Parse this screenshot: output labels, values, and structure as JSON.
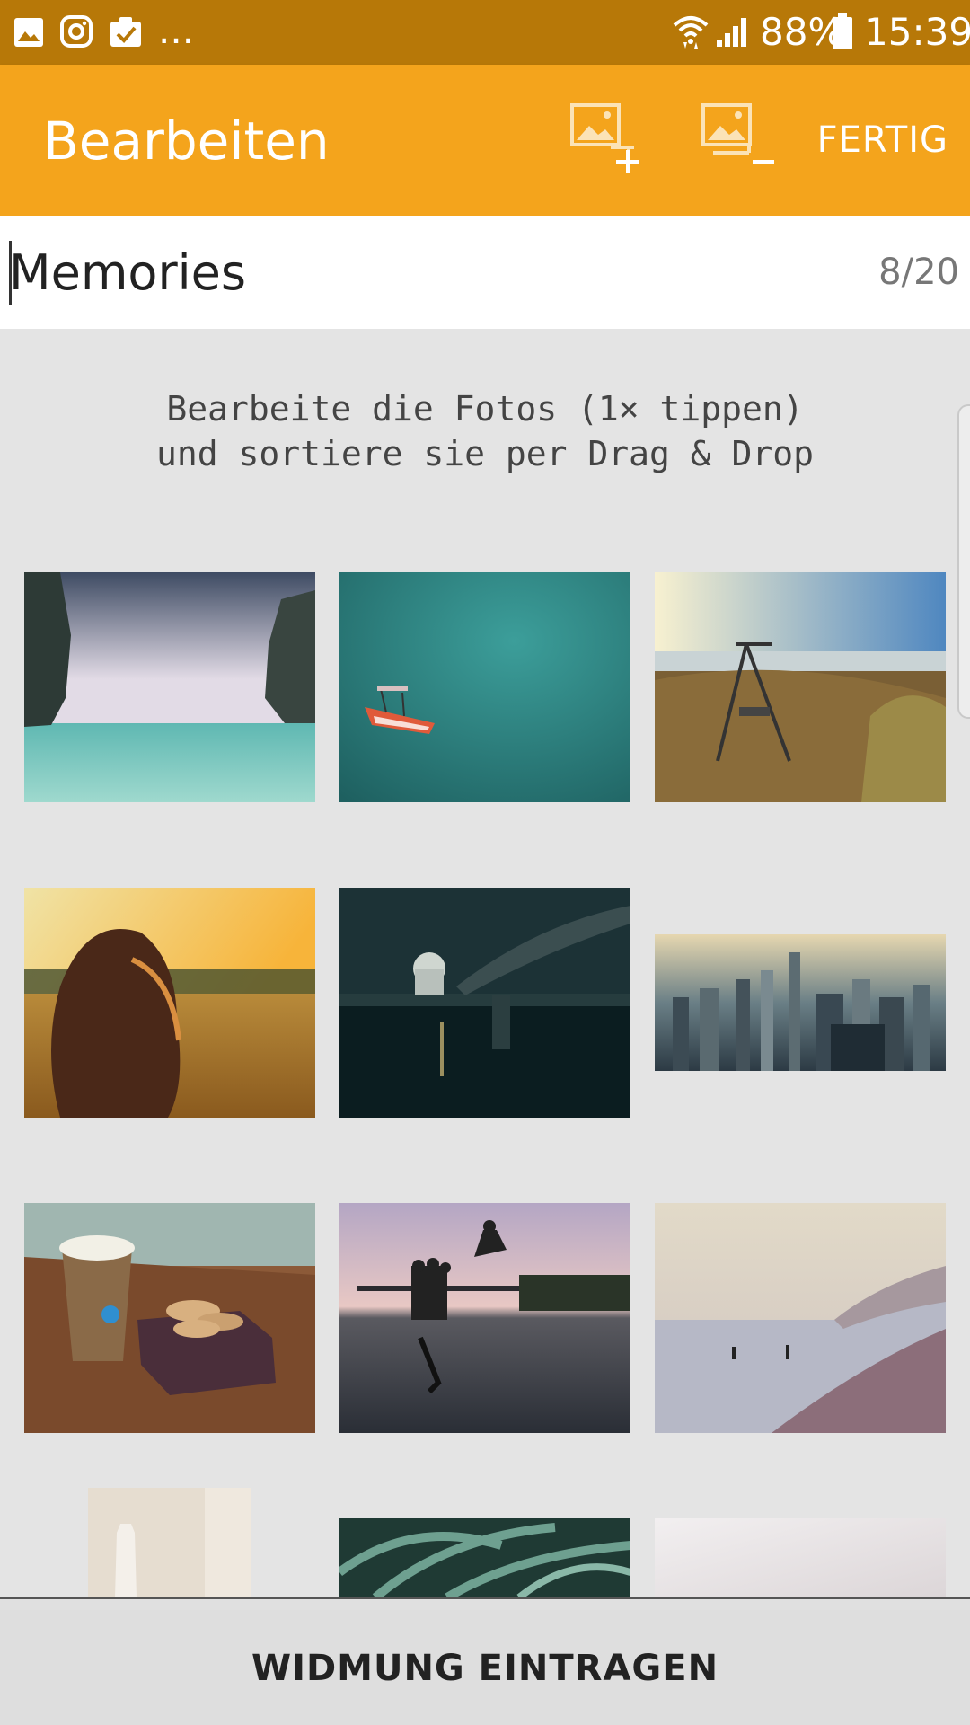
{
  "status_bar": {
    "battery": "88%",
    "time": "15:39",
    "overflow": "...",
    "icons": [
      "gallery-icon",
      "instagram-icon",
      "clipboard-check-icon",
      "wifi-icon",
      "signal-icon",
      "battery-icon"
    ]
  },
  "app_bar": {
    "title": "Bearbeiten",
    "add_photo_icon": "add-photo-icon",
    "remove_photo_icon": "remove-photo-icon",
    "done_label": "FERTIG",
    "color": "#f4a41c"
  },
  "title_field": {
    "value": "Memories",
    "counter": "8/20"
  },
  "hint": {
    "line1": "Bearbeite die Fotos (1× tippen)",
    "line2": "und sortiere sie per Drag & Drop"
  },
  "photos": [
    {
      "subject": "sea cliffs"
    },
    {
      "subject": "red boat on turquoise water"
    },
    {
      "subject": "swing at lakeside"
    },
    {
      "subject": "girl in golden field"
    },
    {
      "subject": "city bridge at night"
    },
    {
      "subject": "city skyline"
    },
    {
      "subject": "coffee and macarons"
    },
    {
      "subject": "people jumping at pier"
    },
    {
      "subject": "misty beach"
    },
    {
      "subject": "white vase"
    },
    {
      "subject": "fern leaves"
    },
    {
      "subject": "pale foggy scene"
    }
  ],
  "bottom_action": {
    "label": "WIDMUNG EINTRAGEN"
  }
}
